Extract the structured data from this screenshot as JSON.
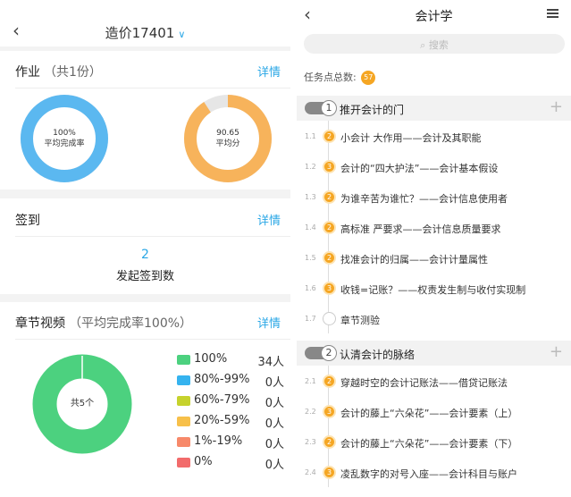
{
  "left": {
    "header_title": "造价17401",
    "homework": {
      "title": "作业",
      "sub": "（共1份）",
      "link": "详情",
      "completion": {
        "value": "100%",
        "label": "平均完成率",
        "fraction": 1.0,
        "color": "#5bb8f0"
      },
      "score": {
        "value": "90.65",
        "label": "平均分",
        "fraction": 0.9065,
        "color": "#f7b35b"
      }
    },
    "signin": {
      "title": "签到",
      "link": "详情",
      "count": "2",
      "label": "发起签到数"
    },
    "video": {
      "title": "章节视频",
      "sub": "（平均完成率100%）",
      "link": "详情",
      "center": "共5个",
      "donut_color": "#4cd17f",
      "legend": [
        {
          "label": "100%",
          "count": "34人",
          "color": "#4cd17f"
        },
        {
          "label": "80%-99%",
          "count": "0人",
          "color": "#35b3ef"
        },
        {
          "label": "60%-79%",
          "count": "0人",
          "color": "#c6d22d"
        },
        {
          "label": "20%-59%",
          "count": "0人",
          "color": "#f7c04a"
        },
        {
          "label": "1%-19%",
          "count": "0人",
          "color": "#f7896a"
        },
        {
          "label": "0%",
          "count": "0人",
          "color": "#f26b6b"
        }
      ]
    }
  },
  "right": {
    "header_title": "会计学",
    "search_placeholder": "搜索",
    "total_label": "任务点总数:",
    "total_count": "57",
    "chapters": [
      {
        "index": "1",
        "title": "推开会计的门",
        "items": [
          {
            "num": "1.1",
            "badge": "2",
            "text": "小会计 大作用——会计及其职能"
          },
          {
            "num": "1.2",
            "badge": "3",
            "text": "会计的“四大护法”——会计基本假设"
          },
          {
            "num": "1.3",
            "badge": "2",
            "text": "为谁辛苦为谁忙？——会计信息使用者"
          },
          {
            "num": "1.4",
            "badge": "2",
            "text": "高标准 严要求——会计信息质量要求"
          },
          {
            "num": "1.5",
            "badge": "2",
            "text": "找准会计的归属——会计计量属性"
          },
          {
            "num": "1.6",
            "badge": "3",
            "text": "收钱=记账？——权责发生制与收付实现制"
          },
          {
            "num": "1.7",
            "badge": "",
            "text": "章节测验"
          }
        ]
      },
      {
        "index": "2",
        "title": "认清会计的脉络",
        "items": [
          {
            "num": "2.1",
            "badge": "2",
            "text": "穿越时空的会计记账法——借贷记账法"
          },
          {
            "num": "2.2",
            "badge": "3",
            "text": "会计的藤上“六朵花”——会计要素（上）"
          },
          {
            "num": "2.3",
            "badge": "2",
            "text": "会计的藤上“六朵花”——会计要素（下）"
          },
          {
            "num": "2.4",
            "badge": "3",
            "text": "凌乱数字的对号入座——会计科目与账户"
          }
        ]
      }
    ]
  }
}
